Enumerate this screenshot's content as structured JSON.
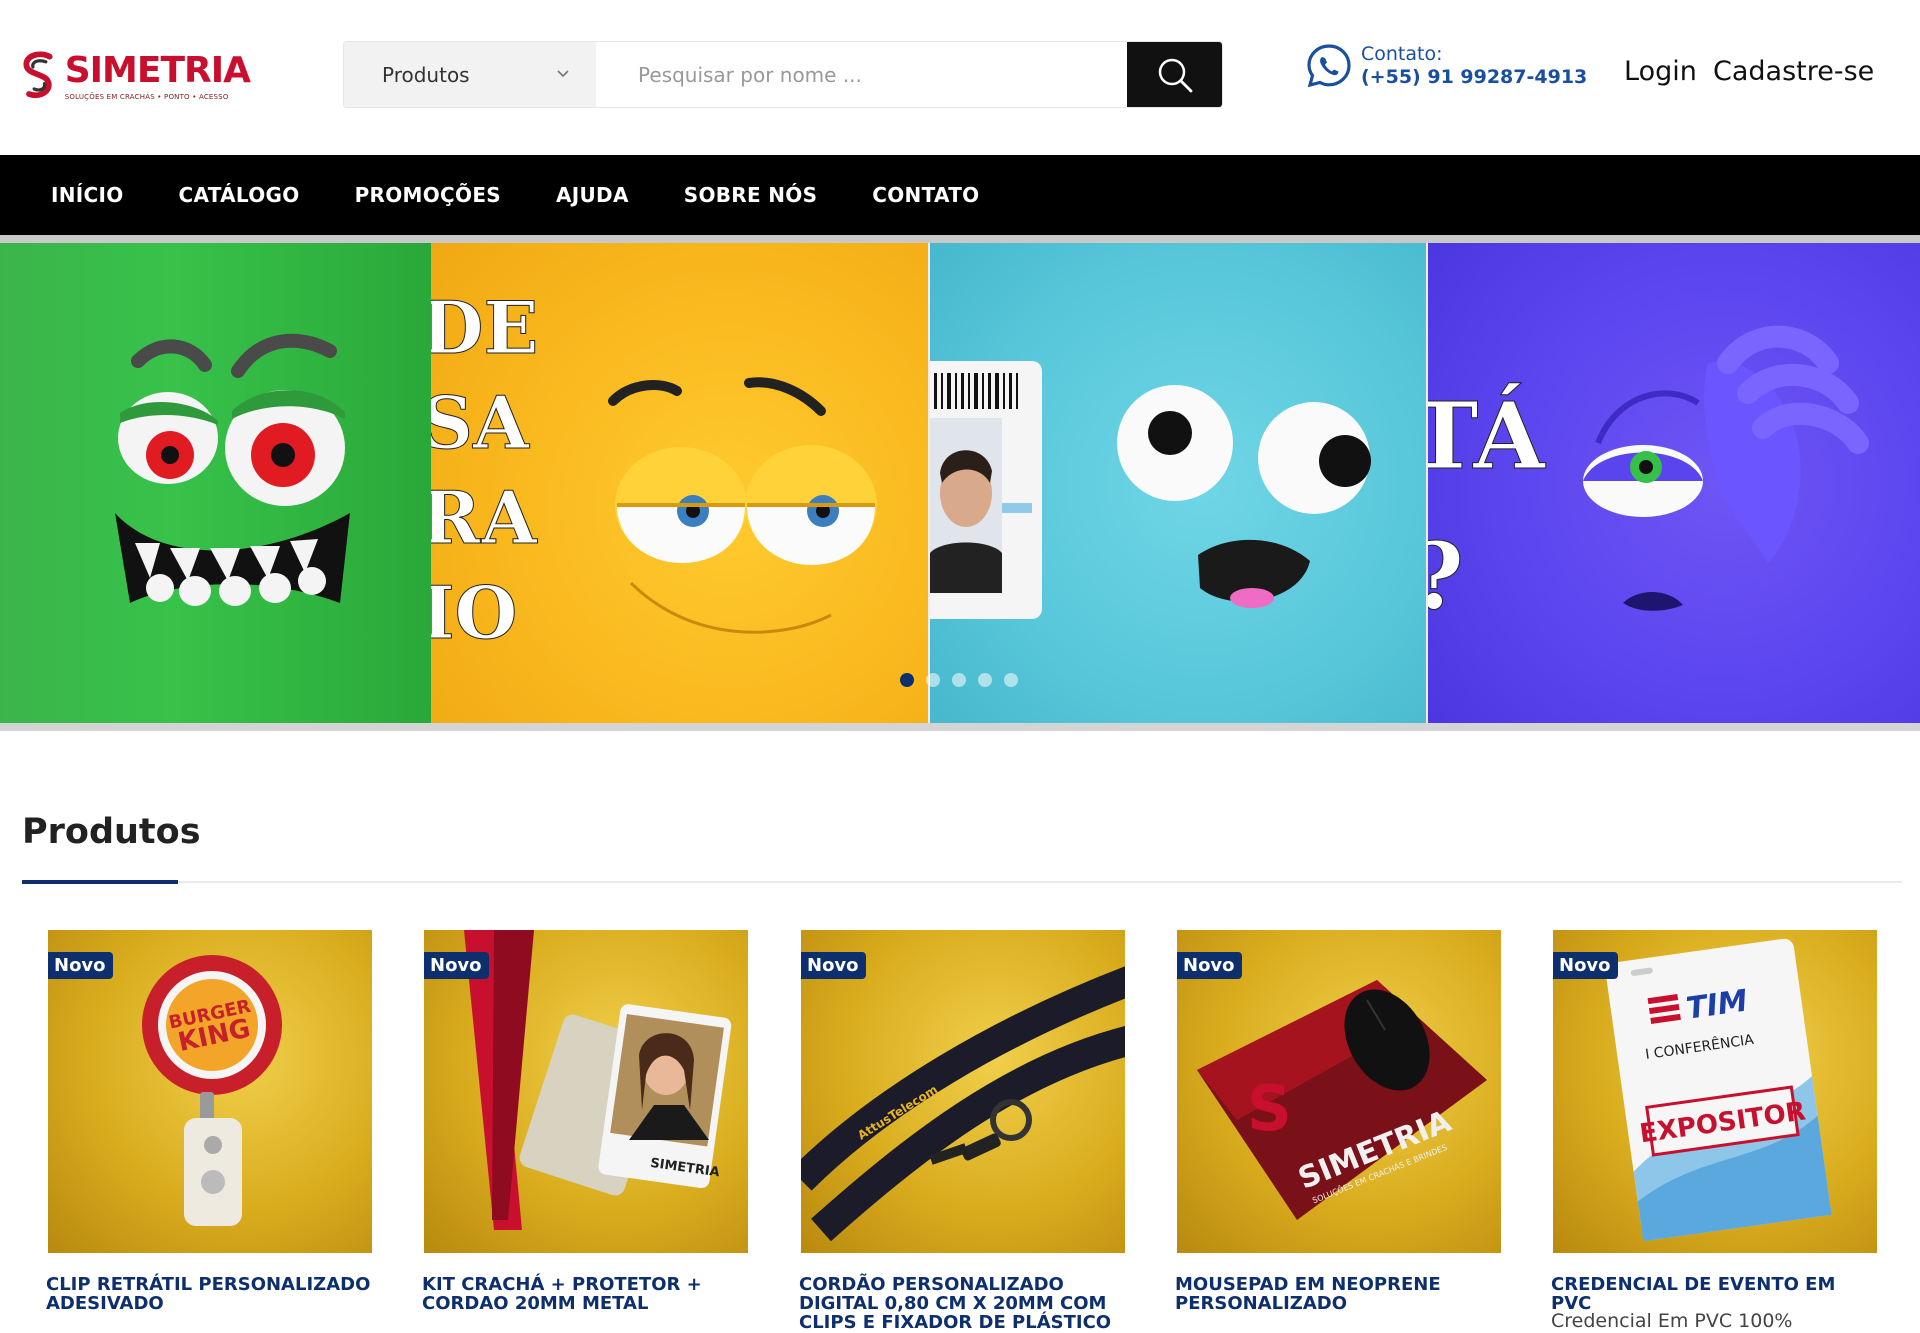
{
  "header": {
    "logo": {
      "name": "SIMETRIA",
      "tagline": "SOLUÇÕES EM CRACHÁS • PONTO • ACESSO"
    },
    "search": {
      "category": "Produtos",
      "placeholder": "Pesquisar por nome ..."
    },
    "contact": {
      "label": "Contato:",
      "phone": "(+55) 91 99287-4913"
    },
    "login": "Login",
    "signup": "Cadastre-se"
  },
  "nav": {
    "items": [
      {
        "label": "INÍCIO"
      },
      {
        "label": "CATÁLOGO"
      },
      {
        "label": "PROMOÇÕES"
      },
      {
        "label": "AJUDA"
      },
      {
        "label": "SOBRE NÓS"
      },
      {
        "label": "CONTATO"
      }
    ]
  },
  "hero": {
    "text_yellow": [
      "DE",
      "SA",
      "RA",
      "IO"
    ],
    "text_purple": [
      "TÁ",
      "?"
    ],
    "slides": 5,
    "active_slide": 1,
    "colors": {
      "green": "#37c24a",
      "yellow": "#f7b31a",
      "cyan": "#58c7da",
      "purple": "#5a44ee"
    }
  },
  "products": {
    "title": "Produtos",
    "items": [
      {
        "badge": "Novo",
        "title": "CLIP RETRÁTIL PERSONALIZADO ADESIVADO",
        "desc": "",
        "brand": "BURGER KING"
      },
      {
        "badge": "Novo",
        "title": "KIT CRACHÁ + PROTETOR + CORDAO 20MM METAL",
        "desc": "",
        "brand": "SIMETRIA"
      },
      {
        "badge": "Novo",
        "title": "CORDÃO PERSONALIZADO DIGITAL 0,80 CM X 20MM COM CLIPS E FIXADOR DE PLÁSTICO",
        "desc": "",
        "brand": "AttusTelecom"
      },
      {
        "badge": "Novo",
        "title": "MOUSEPAD EM NEOPRENE PERSONALIZADO",
        "desc": "",
        "brand": "SIMETRIA",
        "brand_sub": "SOLUÇÕES EM CRACHÁS E BRINDES"
      },
      {
        "badge": "Novo",
        "title": "CREDENCIAL DE EVENTO EM PVC",
        "desc": "Credencial Em PVC 100%",
        "brand": "TIM",
        "brand_sub": "I CONFERÊNCIA",
        "stamp": "EXPOSITOR"
      }
    ]
  },
  "accent_color": "#0d2f6e",
  "brand_color": "#c8102e"
}
